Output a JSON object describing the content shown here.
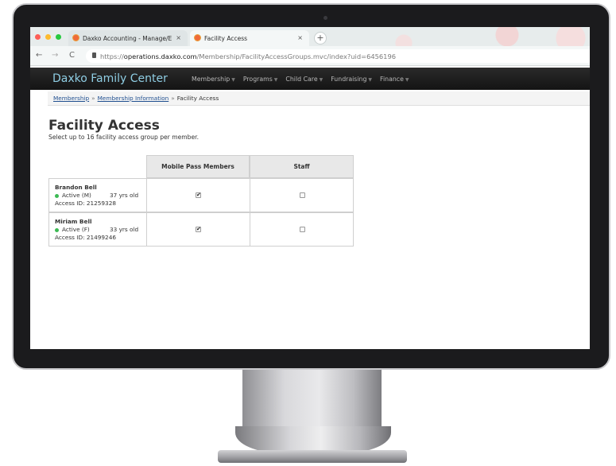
{
  "browser": {
    "tabs": [
      {
        "title": "Daxko Accounting - Manage/E",
        "close": "×"
      },
      {
        "title": "Facility Access",
        "close": "×"
      }
    ],
    "new_tab": "+",
    "nav": {
      "back": "←",
      "forward": "→",
      "reload": "C"
    },
    "url": {
      "scheme": "https://",
      "host": "operations.daxko.com",
      "path": "/Membership/FacilityAccessGroups.mvc/index?uid=6456196"
    }
  },
  "site": {
    "brand": "Daxko Family Center",
    "menu": [
      "Membership",
      "Programs",
      "Child Care",
      "Fundraising",
      "Finance"
    ],
    "caret": "▼"
  },
  "breadcrumb": {
    "items": [
      "Membership",
      "Membership Information"
    ],
    "current": "Facility Access",
    "separator": "»"
  },
  "page": {
    "title": "Facility Access",
    "subtitle": "Select up to 16 facility access group per member."
  },
  "table": {
    "columns": [
      "Mobile Pass Members",
      "Staff"
    ],
    "rows": [
      {
        "name": "Brandon Bell",
        "status": "Active (M)",
        "age": "37 yrs old",
        "access": "Access ID: 21259328",
        "checks": [
          "✔",
          ""
        ]
      },
      {
        "name": "Miriam Bell",
        "status": "Active (F)",
        "age": "33 yrs old",
        "access": "Access ID: 21499246",
        "checks": [
          "✔",
          ""
        ]
      }
    ]
  },
  "colors": {
    "brand": "#8fcde3",
    "link": "#1f4e8f",
    "active_dot": "#3cba54",
    "header_bg": "#1a1a1a"
  }
}
